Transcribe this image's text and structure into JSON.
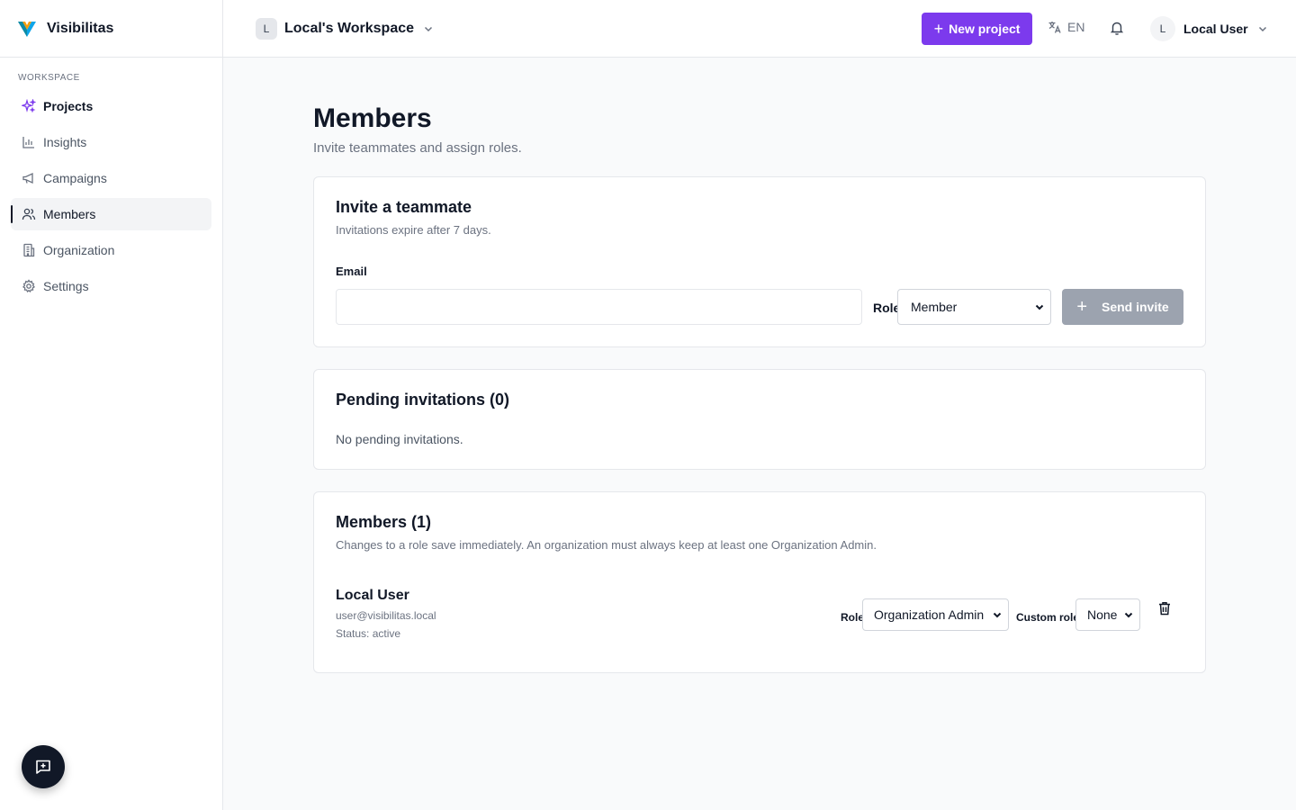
{
  "app": {
    "name": "Visibilitas"
  },
  "sidebar": {
    "section_label": "Workspace",
    "items": [
      {
        "label": "Projects",
        "icon": "sparkles-icon"
      },
      {
        "label": "Insights",
        "icon": "bar-chart-icon"
      },
      {
        "label": "Campaigns",
        "icon": "megaphone-icon"
      },
      {
        "label": "Members",
        "icon": "users-icon"
      },
      {
        "label": "Organization",
        "icon": "building-icon"
      },
      {
        "label": "Settings",
        "icon": "gear-icon"
      }
    ],
    "selected": "Members"
  },
  "topbar": {
    "workspace_initial": "L",
    "workspace_name": "Local's Workspace",
    "new_project_label": "New project",
    "language": "EN",
    "user_initial": "L",
    "user_name": "Local User"
  },
  "page": {
    "title": "Members",
    "subtitle": "Invite teammates and assign roles."
  },
  "invite": {
    "title": "Invite a teammate",
    "subtitle": "Invitations expire after 7 days.",
    "email_label": "Email",
    "email_value": "",
    "role_label": "Role",
    "role_value": "Member",
    "send_label": "Send invite"
  },
  "pending": {
    "title": "Pending invitations (0)",
    "empty_text": "No pending invitations."
  },
  "members": {
    "title": "Members (1)",
    "subtitle": "Changes to a role save immediately. An organization must always keep at least one Organization Admin.",
    "list": [
      {
        "name": "Local User",
        "email": "user@visibilitas.local",
        "status": "Status: active",
        "role_label": "Role",
        "role_value": "Organization Admin",
        "custom_role_label": "Custom role",
        "custom_role_value": "None"
      }
    ]
  },
  "colors": {
    "accent": "#7c3aed",
    "send_disabled": "#9ca3af",
    "fab": "#111827"
  }
}
